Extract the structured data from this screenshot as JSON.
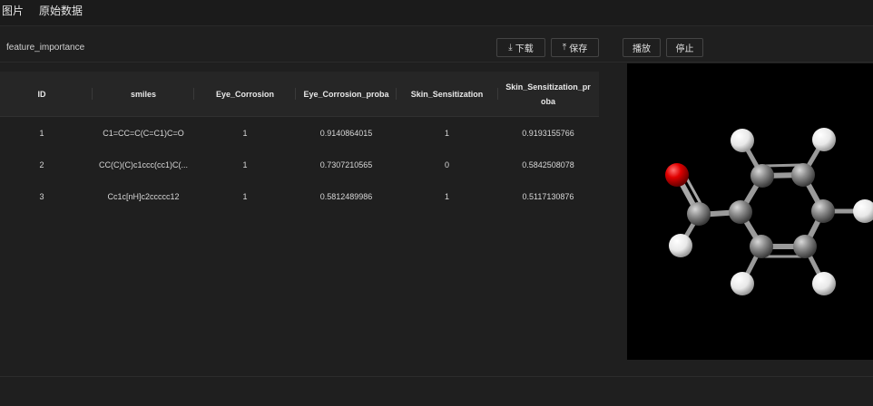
{
  "nav": {
    "tabs": [
      {
        "label": "图片"
      },
      {
        "label": "原始数据"
      }
    ]
  },
  "toolbar": {
    "title": "feature_importance",
    "download_label": "下载",
    "save_label": "保存",
    "play_label": "播放",
    "stop_label": "停止"
  },
  "table": {
    "columns": [
      {
        "label": "ID"
      },
      {
        "label": "smiles"
      },
      {
        "label": "Eye_Corrosion"
      },
      {
        "label": "Eye_Corrosion_proba"
      },
      {
        "label": "Skin_Sensitization"
      },
      {
        "label": "Skin_Sensitization_pr oba"
      }
    ],
    "rows": [
      {
        "c0": "1",
        "c1": "C1=CC=C(C=C1)C=O",
        "c2": "1",
        "c3": "0.9140864015",
        "c4": "1",
        "c5": "0.9193155766"
      },
      {
        "c0": "2",
        "c1": "CC(C)(C)c1ccc(cc1)C(...",
        "c2": "1",
        "c3": "0.7307210565",
        "c4": "0",
        "c5": "0.5842508078"
      },
      {
        "c0": "3",
        "c1": "Cc1c[nH]c2ccccc12",
        "c2": "1",
        "c3": "0.5812489986",
        "c4": "1",
        "c5": "0.5117130876"
      }
    ]
  },
  "viewer": {
    "background": "#000000",
    "atom_colors": {
      "carbon": "#8a8a8a",
      "hydrogen": "#f0f0f0",
      "oxygen": "#e00000"
    }
  }
}
